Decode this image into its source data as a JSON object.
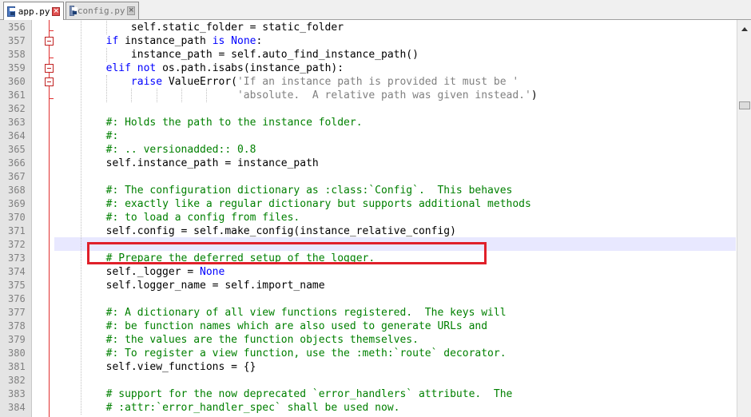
{
  "tabs": [
    {
      "label": "app.py",
      "active": true
    },
    {
      "label": "config.py",
      "active": false
    }
  ],
  "lines": [
    {
      "n": "356",
      "t": "            self.static_folder = static_folder"
    },
    {
      "n": "357",
      "t": "        if instance_path is None:"
    },
    {
      "n": "358",
      "t": "            instance_path = self.auto_find_instance_path()"
    },
    {
      "n": "359",
      "t": "        elif not os.path.isabs(instance_path):"
    },
    {
      "n": "360",
      "t": "            raise ValueError('If an instance path is provided it must be '"
    },
    {
      "n": "361",
      "t": "                             'absolute.  A relative path was given instead.')"
    },
    {
      "n": "362",
      "t": ""
    },
    {
      "n": "363",
      "t": "        #: Holds the path to the instance folder."
    },
    {
      "n": "364",
      "t": "        #:"
    },
    {
      "n": "365",
      "t": "        #: .. versionadded:: 0.8"
    },
    {
      "n": "366",
      "t": "        self.instance_path = instance_path"
    },
    {
      "n": "367",
      "t": ""
    },
    {
      "n": "368",
      "t": "        #: The configuration dictionary as :class:`Config`.  This behaves"
    },
    {
      "n": "369",
      "t": "        #: exactly like a regular dictionary but supports additional methods"
    },
    {
      "n": "370",
      "t": "        #: to load a config from files."
    },
    {
      "n": "371",
      "t": "        self.config = self.make_config(instance_relative_config)"
    },
    {
      "n": "372",
      "t": ""
    },
    {
      "n": "373",
      "t": "        # Prepare the deferred setup of the logger."
    },
    {
      "n": "374",
      "t": "        self._logger = None"
    },
    {
      "n": "375",
      "t": "        self.logger_name = self.import_name"
    },
    {
      "n": "376",
      "t": ""
    },
    {
      "n": "377",
      "t": "        #: A dictionary of all view functions registered.  The keys will"
    },
    {
      "n": "378",
      "t": "        #: be function names which are also used to generate URLs and"
    },
    {
      "n": "379",
      "t": "        #: the values are the function objects themselves."
    },
    {
      "n": "380",
      "t": "        #: To register a view function, use the :meth:`route` decorator."
    },
    {
      "n": "381",
      "t": "        self.view_functions = {}"
    },
    {
      "n": "382",
      "t": ""
    },
    {
      "n": "383",
      "t": "        # support for the now deprecated `error_handlers` attribute.  The"
    },
    {
      "n": "384",
      "t": "        # :attr:`error_handler_spec` shall be used now."
    }
  ],
  "colors": {
    "keyword": "#0000ff",
    "comment": "#008000",
    "string": "#808080",
    "number": "#ff8000",
    "highlight_box": "#e0202a",
    "current_line": "#e8e8ff"
  }
}
